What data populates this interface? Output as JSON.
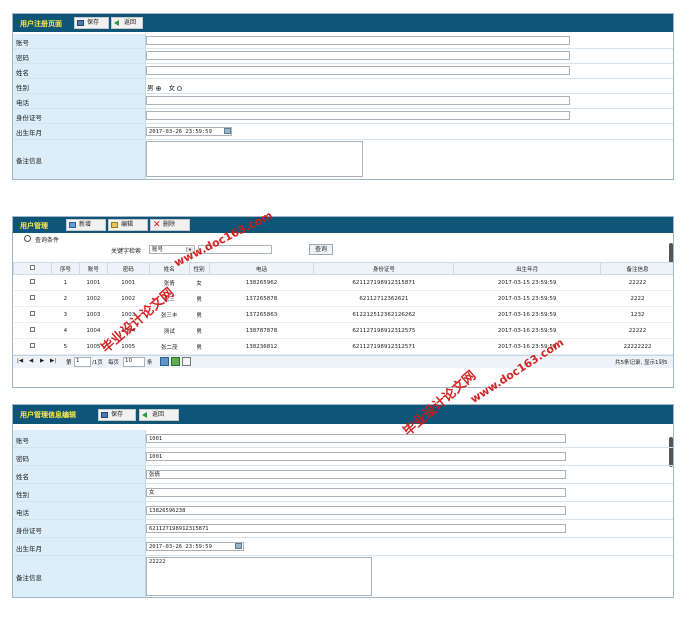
{
  "panel1": {
    "title": "用户注册页面",
    "save_label": "保存",
    "back_label": "返回",
    "fields": [
      {
        "label": "账号",
        "value": ""
      },
      {
        "label": "密码",
        "value": ""
      },
      {
        "label": "姓名",
        "value": ""
      },
      {
        "label": "性别",
        "male": "男",
        "female": "女",
        "selected": "男"
      },
      {
        "label": "电话",
        "value": ""
      },
      {
        "label": "身份证号",
        "value": ""
      },
      {
        "label": "出生年月",
        "value": "2017-03-26 23:59:59"
      },
      {
        "label": "备注信息",
        "value": ""
      }
    ]
  },
  "panel2": {
    "title": "用户管理",
    "new_label": "新增",
    "edit_label": "编辑",
    "delete_label": "删除",
    "query_title": "查询条件",
    "keyword_label": "关键字检索",
    "keyword_select": "账号",
    "query_button": "查询",
    "columns": [
      "序号",
      "账号",
      "密码",
      "姓名",
      "性别",
      "电话",
      "身份证号",
      "出生年月",
      "备注信息"
    ],
    "rows": [
      [
        "1",
        "1001",
        "1001",
        "张倩",
        "女",
        "138265962",
        "621127198912315871",
        "2017-03-15 23:59:59",
        "22222"
      ],
      [
        "2",
        "1002",
        "1002",
        "张三",
        "男",
        "137265878",
        "62112712362621",
        "2017-03-15 23:59:59",
        "2222"
      ],
      [
        "3",
        "1003",
        "1003",
        "张三丰",
        "男",
        "137265863",
        "612212512362126262",
        "2017-03-16 23:59:59",
        "1232"
      ],
      [
        "4",
        "1004",
        "1004",
        "测试",
        "男",
        "138787878",
        "621127198912312575",
        "2017-03-16 23:59:59",
        "22222"
      ],
      [
        "5",
        "1005",
        "1005",
        "张二茂",
        "男",
        "138236812",
        "621127198912312571",
        "2017-03-16 23:59:59",
        "22222222"
      ]
    ],
    "pager": {
      "page_prefix": "第",
      "page_value": "1",
      "page_suffix": "/1页",
      "per_page_label": "每页",
      "per_page_value": "10",
      "per_page_unit": "条",
      "summary": "共5条记录, 显示1到5"
    }
  },
  "panel3": {
    "title": "用户管理信息编辑",
    "save_label": "保存",
    "back_label": "返回",
    "fields": [
      {
        "label": "账号",
        "value": "1001"
      },
      {
        "label": "密码",
        "value": "1001"
      },
      {
        "label": "姓名",
        "value": "张倩"
      },
      {
        "label": "性别",
        "value": "女"
      },
      {
        "label": "电话",
        "value": "13826596238"
      },
      {
        "label": "身份证号",
        "value": "621127198912315871"
      },
      {
        "label": "出生年月",
        "value": "2017-03-26 23:59:59"
      },
      {
        "label": "备注信息",
        "value": "22222"
      }
    ]
  },
  "watermarks": {
    "cn": "毕业设计论文网",
    "url": "www.doc163.com"
  }
}
